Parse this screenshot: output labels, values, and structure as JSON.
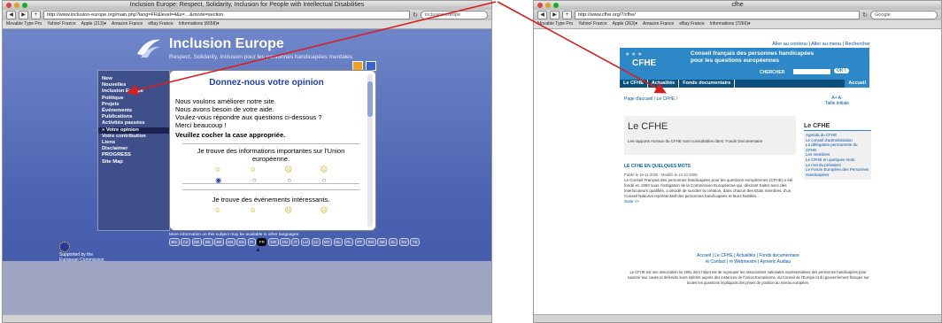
{
  "left_window": {
    "title": "Inclusion Europe: Respect, Solidarity, Inclusion for People with Intellectual Disabilities",
    "url": "http://www.inclusion-europe.org/main.php?lang=FR&level=4&s=…&mode=section",
    "search_value": "inclusion europe",
    "bookmarks": [
      "Movable Type Pro",
      "Yahoo! France",
      "Apple (213)▾",
      "Amazon France",
      "eBay France",
      "Informations (6658)▾"
    ],
    "site": {
      "title": "Inclusion Europe",
      "subtitle": "Respect, Solidarity, Inclusion pour les personnes handicapées mentales",
      "nav": [
        "New",
        "Nouvelles",
        "Inclusion Europe",
        "Politique",
        "Projets",
        "Événements",
        "Publications",
        "Activités passées",
        "» Votre opinion",
        "Votre contribution",
        "Liens",
        "Disclaimer",
        "PROGRESS",
        "Site Map"
      ],
      "nav_active_index": 8,
      "panel_heading": "Donnez-nous votre opinion",
      "intro_lines": [
        "Nous voulons améliorer notre site.",
        "Nous avons besoin de votre aide.",
        "Voulez-vous répondre aux questions ci-dessous ?",
        "Merci beaucoup !"
      ],
      "instruction": "Veuillez cocher la case appropriée.",
      "question1": "Je trouve des informations importantes sur l'Union européenne.",
      "question2": "Je trouve des événements intéressants.",
      "more_info": "More information on this subject may be available in other languages:",
      "languages": [
        "BG",
        "CZ",
        "DE",
        "DK",
        "EE",
        "EN",
        "ES",
        "FI",
        "FR",
        "GR",
        "HU",
        "IT",
        "LU",
        "LV",
        "MT",
        "NL",
        "PL",
        "PT",
        "RO",
        "SK",
        "SL",
        "SV",
        "TK"
      ],
      "selected_language": "FR",
      "supported": [
        "Supported by the",
        "European Commission"
      ]
    }
  },
  "right_window": {
    "title": "cfhe",
    "url": "http://www.cfhe.org/?/cfhe/",
    "search_placeholder": "Google",
    "bookmarks": [
      "Movable Type Pro",
      "Yahoo! France",
      "Apple (263)▾",
      "Amazon France",
      "eBay France",
      "Informations (7266)▾"
    ],
    "site": {
      "top_links": "Aller au contenu | Aller au menu | Rechercher",
      "logo": "CFHE",
      "org_line1": "Conseil français des personnes handicapées",
      "org_line2": "pour les questions européennes",
      "search_label": "CHERCHER",
      "ok_label": "OK !",
      "nav": [
        "Le CFHE",
        "Actualités",
        "Fonds documentaire"
      ],
      "nav_right": "Accueil",
      "breadcrumb": "Page d'accueil / Le CFHE /",
      "text_size_a": "A+  A-",
      "text_size_label": "Taille initiale",
      "heading": "Le CFHE",
      "reports": "Les rapports moraux du CFHE sont consultables dans: Fonds Documentaire",
      "subheading": "LE CFHE EN QUELQUES MOTS",
      "published": "Publié le 16-11-2005 - Modifié le 13-10-2008",
      "body": "Le Conseil Français des personnes handicapées pour les questions européennes (CFHE) a été fondé en 1993 sous l'instigation de la Commission Européenne qui, désirant traiter avec des interlocuteurs qualifiés, a décidé de susciter la création, dans chacun des Etats membres, d'un Conseil National représentatif des personnes handicapées et leurs familles...",
      "more": "Suite >>",
      "side_heading": "Le CFHE",
      "side_links": [
        "Agenda du CFHE",
        "Le conseil d'administration",
        "La délégation permanente du CFHE",
        "Les membres",
        "Le CFHE en quelques mots",
        "Le mot du président",
        "Le Forum Européen des Personnes Handicapées"
      ],
      "footer_links1": "Accueil | Le CFHE | Actualités | Fonds documentaire",
      "footer_links2": "✉ Contact | ✉ Webmestre | Aymeric Audiau",
      "footer_text": "Le CFHE est une association loi 1901 dont l'objet est de regrouper les associations nationales représentatives des personnes handicapées pour soutenir leur cause et défendre leurs intérêts auprès des instances de l'Union Européenne, du Conseil de l'Europe et du gouvernement français sur toutes les questions impliquant des prises de position au niveau européen."
    }
  },
  "colors": {
    "ie_blue": "#4b63b0",
    "cfhe_blue": "#2e87c7",
    "annotation_arrow": "#d81f1f"
  }
}
